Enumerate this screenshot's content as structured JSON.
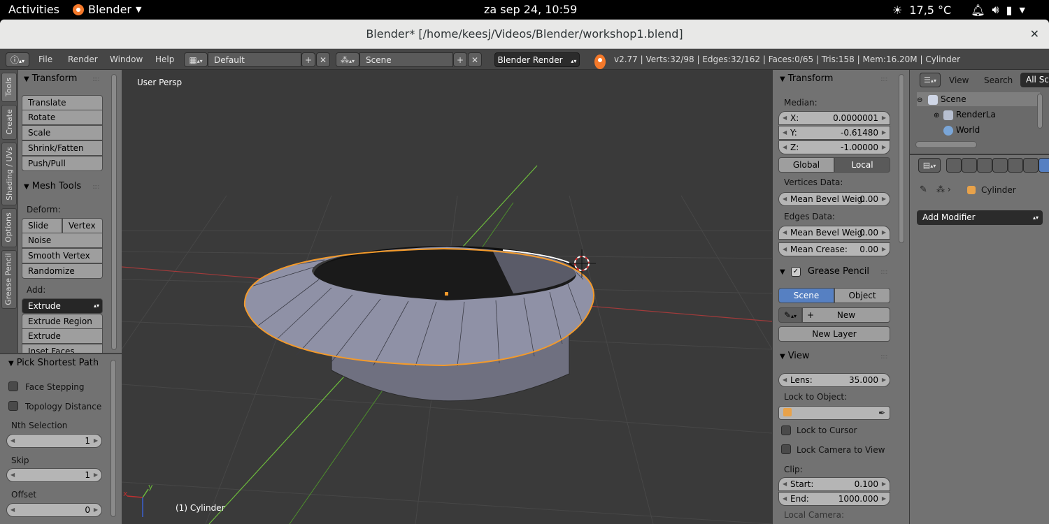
{
  "topbar": {
    "activities": "Activities",
    "app": "Blender",
    "clock": "za sep 24, 10:59",
    "temp": "17,5 °C"
  },
  "window": {
    "title": "Blender* [/home/keesj/Videos/Blender/workshop1.blend]"
  },
  "header": {
    "menus": [
      "File",
      "Render",
      "Window",
      "Help"
    ],
    "layout": "Default",
    "scene": "Scene",
    "engine": "Blender Render",
    "stats": "v2.77 | Verts:32/98 | Edges:32/162 | Faces:0/65 | Tris:158 | Mem:16.20M | Cylinder"
  },
  "left_tabs": [
    "Tools",
    "Create",
    "Shading / UVs",
    "Options",
    "Grease Pencil"
  ],
  "left_panel": {
    "transform_title": "Transform",
    "transform_buttons": [
      "Translate",
      "Rotate",
      "Scale",
      "Shrink/Fatten",
      "Push/Pull"
    ],
    "mesh_tools_title": "Mesh Tools",
    "deform_label": "Deform:",
    "slide_edge": "Slide Ed",
    "vertex": "Vertex",
    "deform_buttons": [
      "Noise",
      "Smooth Vertex",
      "Randomize"
    ],
    "add_label": "Add:",
    "extrude": "Extrude",
    "add_buttons": [
      "Extrude Region",
      "Extrude Individual",
      "Inset Faces"
    ]
  },
  "operator_panel": {
    "title": "Pick Shortest Path",
    "face_stepping": "Face Stepping",
    "topology_distance": "Topology Distance",
    "nth_label": "Nth Selection",
    "nth_value": "1",
    "skip_label": "Skip",
    "skip_value": "1",
    "offset_label": "Offset",
    "offset_value": "0"
  },
  "viewport": {
    "view_name": "User Persp",
    "object_name": "(1) Cylinder",
    "axis_y": "y",
    "axis_x": "x"
  },
  "right_panel": {
    "transform_title": "Transform",
    "median_label": "Median:",
    "x_label": "X:",
    "x_value": "0.0000001",
    "y_label": "Y:",
    "y_value": "-0.61480",
    "z_label": "Z:",
    "z_value": "-1.00000",
    "global": "Global",
    "local": "Local",
    "vertices_data": "Vertices Data:",
    "mean_bevel_v_label": "Mean Bevel Weig:",
    "mean_bevel_v_value": "0.00",
    "edges_data": "Edges Data:",
    "mean_bevel_e_label": "Mean Bevel Weig:",
    "mean_bevel_e_value": "0.00",
    "mean_crease_label": "Mean Crease:",
    "mean_crease_value": "0.00",
    "grease_title": "Grease Pencil",
    "gp_scene": "Scene",
    "gp_object": "Object",
    "gp_new": "New",
    "gp_new_layer": "New Layer",
    "view_title": "View",
    "lens_label": "Lens:",
    "lens_value": "35.000",
    "lock_to_object": "Lock to Object:",
    "lock_to_cursor": "Lock to Cursor",
    "lock_camera": "Lock Camera to View",
    "clip_label": "Clip:",
    "start_label": "Start:",
    "start_value": "0.100",
    "end_label": "End:",
    "end_value": "1000.000",
    "local_camera": "Local Camera:"
  },
  "outliner": {
    "view": "View",
    "search": "Search",
    "all_scenes": "All Sc",
    "items": [
      "Scene",
      "RenderLa",
      "World"
    ]
  },
  "properties": {
    "object": "Cylinder",
    "add_modifier": "Add Modifier"
  },
  "colors": {
    "selection_orange": "#f39a2b",
    "active_blue": "#5680c2",
    "axis_red": "#a33a3a",
    "axis_green": "#6dbb3c",
    "mesh_face": "#8f91a6"
  }
}
